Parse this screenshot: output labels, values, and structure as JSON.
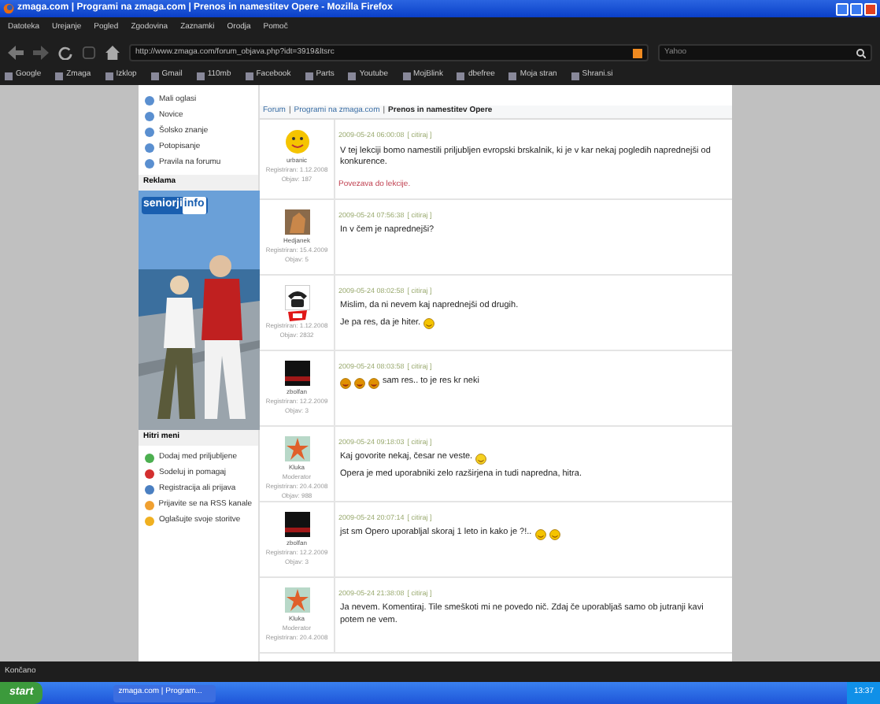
{
  "window": {
    "title": "zmaga.com | Programi na zmaga.com | Prenos in namestitev Opere - Mozilla Firefox"
  },
  "menu": [
    "Datoteka",
    "Urejanje",
    "Pogled",
    "Zgodovina",
    "Zaznamki",
    "Orodja",
    "Pomoč"
  ],
  "address": {
    "value": "http://www.zmaga.com/forum_objava.php?idt=3919&ltsrc"
  },
  "search": {
    "placeholder": "Yahoo"
  },
  "bookmarks": [
    "Google",
    "Zmaga",
    "Izklop",
    "Gmail",
    "110mb",
    "Facebook",
    "Parts",
    "Youtube",
    "MojBlink",
    "dbefree",
    "Moja stran",
    "Shrani.si"
  ],
  "sidebar": {
    "items": [
      "Mali oglasi",
      "Novice",
      "Šolsko znanje",
      "Potopisanje",
      "Pravila na forumu"
    ],
    "ad_title": "Reklama",
    "ad_logo": [
      "seniorji",
      "info"
    ],
    "quick_title": "Hitri meni",
    "quick_items": [
      {
        "label": "Dodaj med priljubljene",
        "color": "#4caf50"
      },
      {
        "label": "Sodeluj in pomagaj",
        "color": "#d32f2f"
      },
      {
        "label": "Registracija ali prijava",
        "color": "#4a7fc1"
      },
      {
        "label": "Prijavite se na RSS kanale",
        "color": "#f0a030"
      },
      {
        "label": "Oglašujte svoje storitve",
        "color": "#f0b020"
      }
    ]
  },
  "breadcrumb": {
    "separator": "|",
    "items": [
      "Forum",
      "Programi na zmaga.com",
      "Prenos in namestitev Opere"
    ]
  },
  "posts": [
    {
      "avatar": {
        "kind": "smiley"
      },
      "rank_badge": false,
      "author": "urbanic",
      "registered": "Registriran: 1.12.2008",
      "count": "Objav: 187",
      "date": "2009-05-24 06:00:08",
      "quote": "[ citiraj ]",
      "paragraphs": [
        {
          "text": "V tej lekciji bomo namestili priljubljen evropski brskalnik, ki je v kar nekaj pogledih naprednejši od konkurence."
        }
      ],
      "link": "Povezava do lekcije."
    },
    {
      "avatar": {
        "kind": "horse"
      },
      "rank_badge": false,
      "author": "Hedjanek",
      "registered": "Registriran: 15.4.2009",
      "count": "Objav: 5",
      "date": "2009-05-24 07:56:38",
      "quote": "[ citiraj ]",
      "paragraphs": [
        {
          "text": "In v čem je naprednejši?"
        }
      ]
    },
    {
      "avatar": {
        "kind": "phone"
      },
      "rank_badge": true,
      "registered": "Registriran: 1.12.2008",
      "count": "Objav: 2832",
      "date": "2009-05-24 08:02:58",
      "quote": "[ citiraj ]",
      "paragraphs": [
        {
          "text": "Mislim, da ni nevem kaj naprednejši od drugih."
        },
        {
          "text": "Je pa res, da je hiter.",
          "after": [
            {
              "kind": "wink"
            }
          ]
        }
      ]
    },
    {
      "avatar": {
        "kind": "dark"
      },
      "rank_badge": false,
      "author": "zbolfan",
      "registered": "Registriran: 12.2.2009",
      "count": "Objav: 3",
      "date": "2009-05-24 08:03:58",
      "quote": "[ citiraj ]",
      "paragraphs": [
        {
          "before": [
            {
              "kind": "laugh"
            },
            {
              "kind": "laugh"
            },
            {
              "kind": "laugh"
            }
          ],
          "text": "sam res.. to je res kr neki"
        }
      ]
    },
    {
      "avatar": {
        "kind": "starfish"
      },
      "rank_badge": false,
      "author": "Kluka",
      "role": "Moderator",
      "registered": "Registriran: 20.4.2008",
      "count": "Objav: 988",
      "date": "2009-05-24 09:18:03",
      "quote": "[ citiraj ]",
      "paragraphs": [
        {
          "text": "Kaj govorite nekaj, česar ne veste.",
          "after": [
            {
              "kind": "grin"
            }
          ]
        },
        {
          "text": "Opera je med uporabniki zelo razširjena in tudi napredna, hitra."
        }
      ]
    },
    {
      "avatar": {
        "kind": "dark"
      },
      "rank_badge": false,
      "author": "zbolfan",
      "registered": "Registriran: 12.2.2009",
      "count": "Objav: 3",
      "date": "2009-05-24 20:07:14",
      "quote": "[ citiraj ]",
      "paragraphs": [
        {
          "text": "jst sm Opero uporabljal skoraj 1 leto in kako je ?!..",
          "after": [
            {
              "kind": "wink"
            },
            {
              "kind": "wink"
            }
          ]
        }
      ]
    },
    {
      "avatar": {
        "kind": "starfish"
      },
      "rank_badge": false,
      "author": "Kluka",
      "role": "Moderator",
      "registered": "Registriran: 20.4.2008",
      "date": "2009-05-24 21:38:08",
      "quote": "[ citiraj ]",
      "paragraphs": [
        {
          "text": "Ja nevem. Komentiraj. Tile smeškoti mi ne povedo nič. Zdaj če uporabljaš samo ob jutranji kavi potem ne vem."
        }
      ]
    }
  ],
  "status_bar": "Končano",
  "taskbar": {
    "start": "start",
    "task": "zmaga.com | Program...",
    "clock": "13:37"
  }
}
